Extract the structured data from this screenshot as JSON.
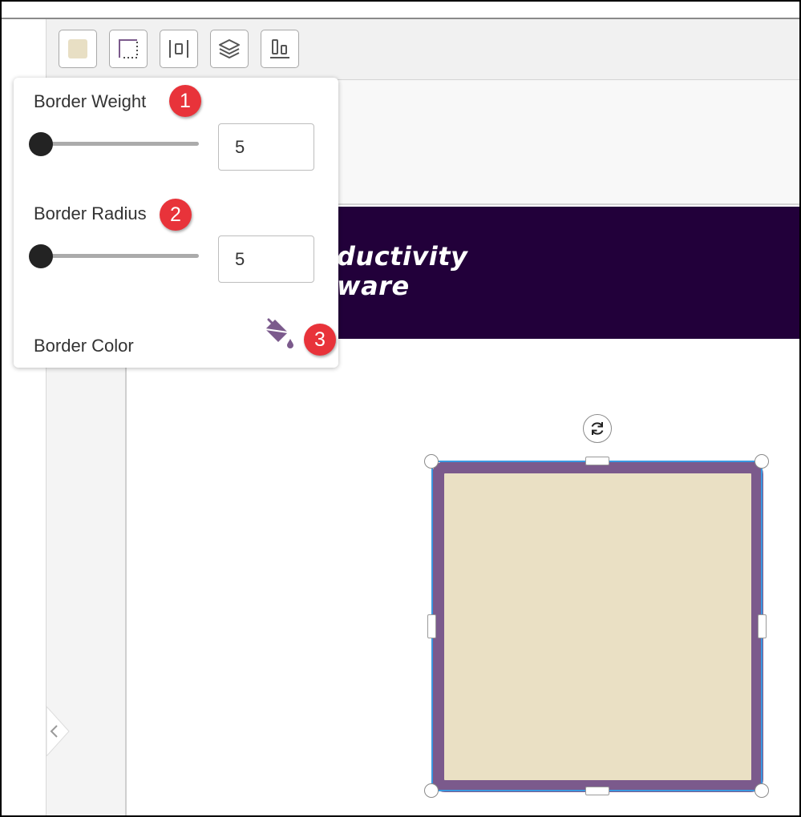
{
  "toolbar": {
    "buttons": [
      {
        "name": "fill-color-button",
        "icon": "fill-swatch-icon",
        "swatch_color": "#e8dfc4"
      },
      {
        "name": "border-style-button",
        "icon": "border-style-icon"
      },
      {
        "name": "distribute-button",
        "icon": "distribute-horizontal-icon"
      },
      {
        "name": "layers-button",
        "icon": "layers-icon"
      },
      {
        "name": "align-button",
        "icon": "align-bottom-icon"
      }
    ]
  },
  "banner": {
    "line1": "ductivity",
    "line2": "ware",
    "background": "#22003a"
  },
  "border_panel": {
    "weight_label": "Border Weight",
    "weight_badge": "1",
    "weight_value": "5",
    "weight_slider_fraction": 0,
    "radius_label": "Border Radius",
    "radius_badge": "2",
    "radius_value": "5",
    "radius_slider_fraction": 0,
    "color_label": "Border Color",
    "color_badge": "3",
    "color_icon": "paint-bucket-icon",
    "color_icon_color": "#7b5a8c"
  },
  "shape": {
    "fill": "#eae0c4",
    "border_color": "#7b5a8c",
    "selection_color": "#3a98e0"
  }
}
